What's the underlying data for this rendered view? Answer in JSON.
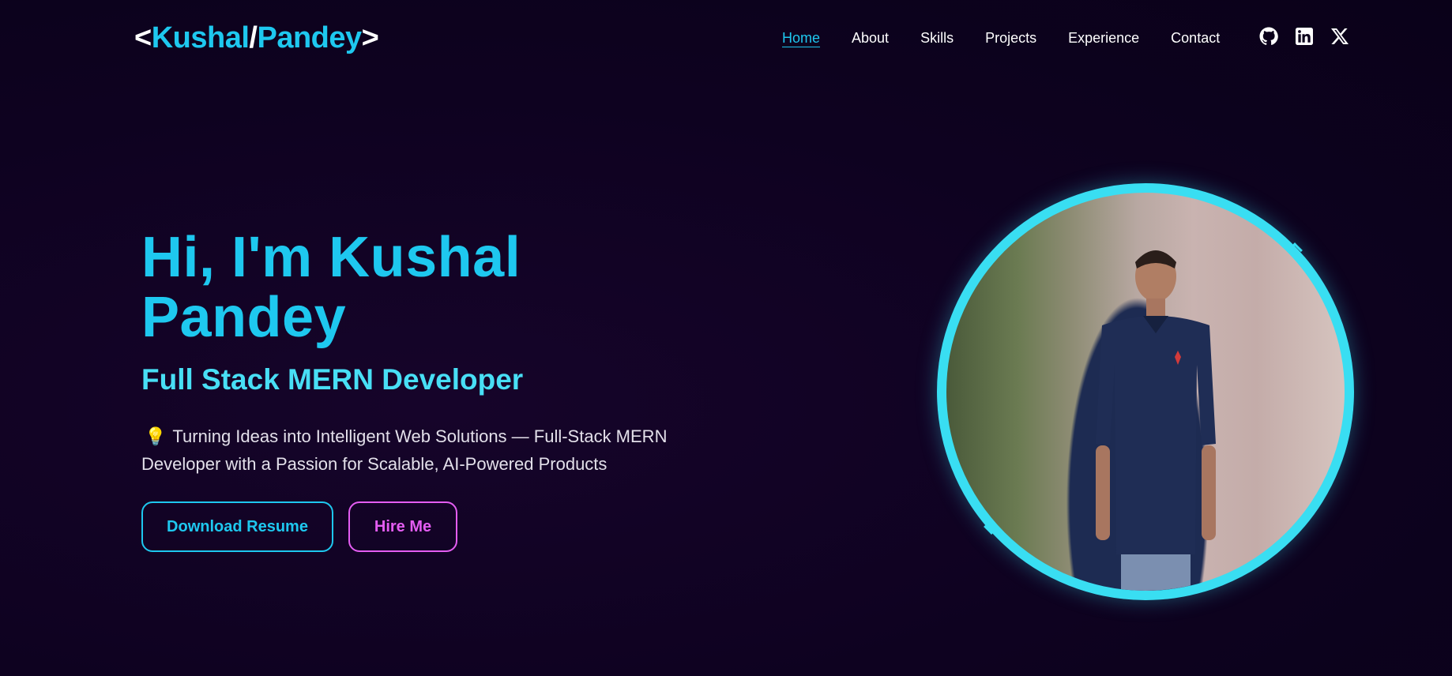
{
  "header": {
    "logo": {
      "open_bracket": "<",
      "first": "Kushal",
      "slash": "/",
      "last": "Pandey",
      "close_bracket": ">"
    },
    "nav": [
      {
        "label": "Home",
        "active": true
      },
      {
        "label": "About",
        "active": false
      },
      {
        "label": "Skills",
        "active": false
      },
      {
        "label": "Projects",
        "active": false
      },
      {
        "label": "Experience",
        "active": false
      },
      {
        "label": "Contact",
        "active": false
      }
    ],
    "socials": [
      "github-icon",
      "linkedin-icon",
      "x-icon"
    ]
  },
  "hero": {
    "title": "Hi, I'm Kushal Pandey",
    "subtitle": "Full Stack MERN Developer",
    "bulb": "💡",
    "description": "Turning Ideas into Intelligent Web Solutions — Full-Stack MERN Developer with a Passion for Scalable, AI-Powered Products",
    "buttons": {
      "resume": "Download Resume",
      "hire": "Hire Me"
    }
  },
  "colors": {
    "accent_cyan": "#1ec8ef",
    "accent_pink": "#e45df2",
    "ring": "#39def2",
    "background": "#0f031f"
  }
}
